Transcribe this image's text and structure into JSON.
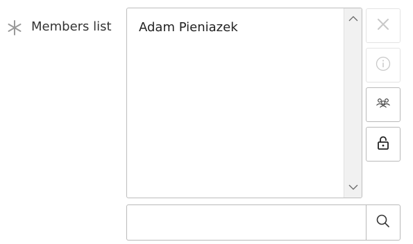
{
  "field": {
    "label": "Members list",
    "required": true
  },
  "members": {
    "items": [
      "Adam Pieniazek"
    ]
  },
  "actions": {
    "remove": {
      "icon": "close-icon",
      "enabled": false
    },
    "info": {
      "icon": "info-icon",
      "enabled": false
    },
    "members": {
      "icon": "users-icon",
      "enabled": true
    },
    "lock": {
      "icon": "unlock-icon",
      "enabled": true
    }
  },
  "search": {
    "value": "",
    "placeholder": "",
    "icon": "search-icon"
  },
  "colors": {
    "border": "#b9b9b9",
    "disabled_icon": "#c8c8c8",
    "icon": "#333333",
    "required_mark": "#9a9a9a",
    "scrollbar_track": "#f1f1f1"
  }
}
